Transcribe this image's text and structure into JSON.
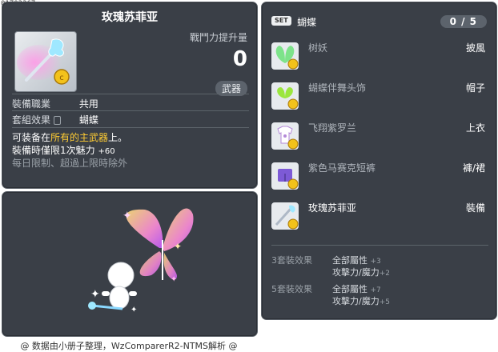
{
  "code": "01702367",
  "item": {
    "title": "玫瑰苏菲亚",
    "stat_label": "戰鬥力提升量",
    "stat_value": "0",
    "category_badge": "武器",
    "job_label": "裝備職業",
    "job_value": "共用",
    "set_label": "套組效果",
    "set_value": "蝴蝶",
    "desc_prefix": "可装备在",
    "desc_highlight": "所有的主武器",
    "desc_suffix": "上。",
    "charm_text": "裝備時僅限1次魅力",
    "charm_value": "+60",
    "limit_text": "每日限制、超過上限時除外"
  },
  "set": {
    "badge": "SET",
    "name": "蝴蝶",
    "count": "0 / 5",
    "items": [
      {
        "name": "树妖",
        "slot": "披風",
        "icon": "wings-icon"
      },
      {
        "name": "蝴蝶伴舞头饰",
        "slot": "帽子",
        "icon": "butterfly-hat-icon"
      },
      {
        "name": "飞翔紫罗兰",
        "slot": "上衣",
        "icon": "shirt-icon"
      },
      {
        "name": "紫色马赛克短裤",
        "slot": "褲/裙",
        "icon": "shorts-icon"
      },
      {
        "name": "玫瑰苏菲亚",
        "slot": "裝備",
        "icon": "wand-icon"
      }
    ],
    "bonuses": [
      {
        "label": "3套裝效果",
        "lines": [
          {
            "stat": "全部屬性",
            "val": "+3"
          },
          {
            "stat": "攻擊力/魔力",
            "val": "+2"
          }
        ]
      },
      {
        "label": "5套裝效果",
        "lines": [
          {
            "stat": "全部屬性",
            "val": "+7"
          },
          {
            "stat": "攻擊力/魔力",
            "val": "+5"
          }
        ]
      }
    ]
  },
  "footer": "@ 数据由小册子整理，WzComparerR2-NTMS解析 @",
  "colors": {
    "panel": "#3a3f47",
    "highlight": "#ffcc33",
    "muted": "#9aa1a8"
  }
}
